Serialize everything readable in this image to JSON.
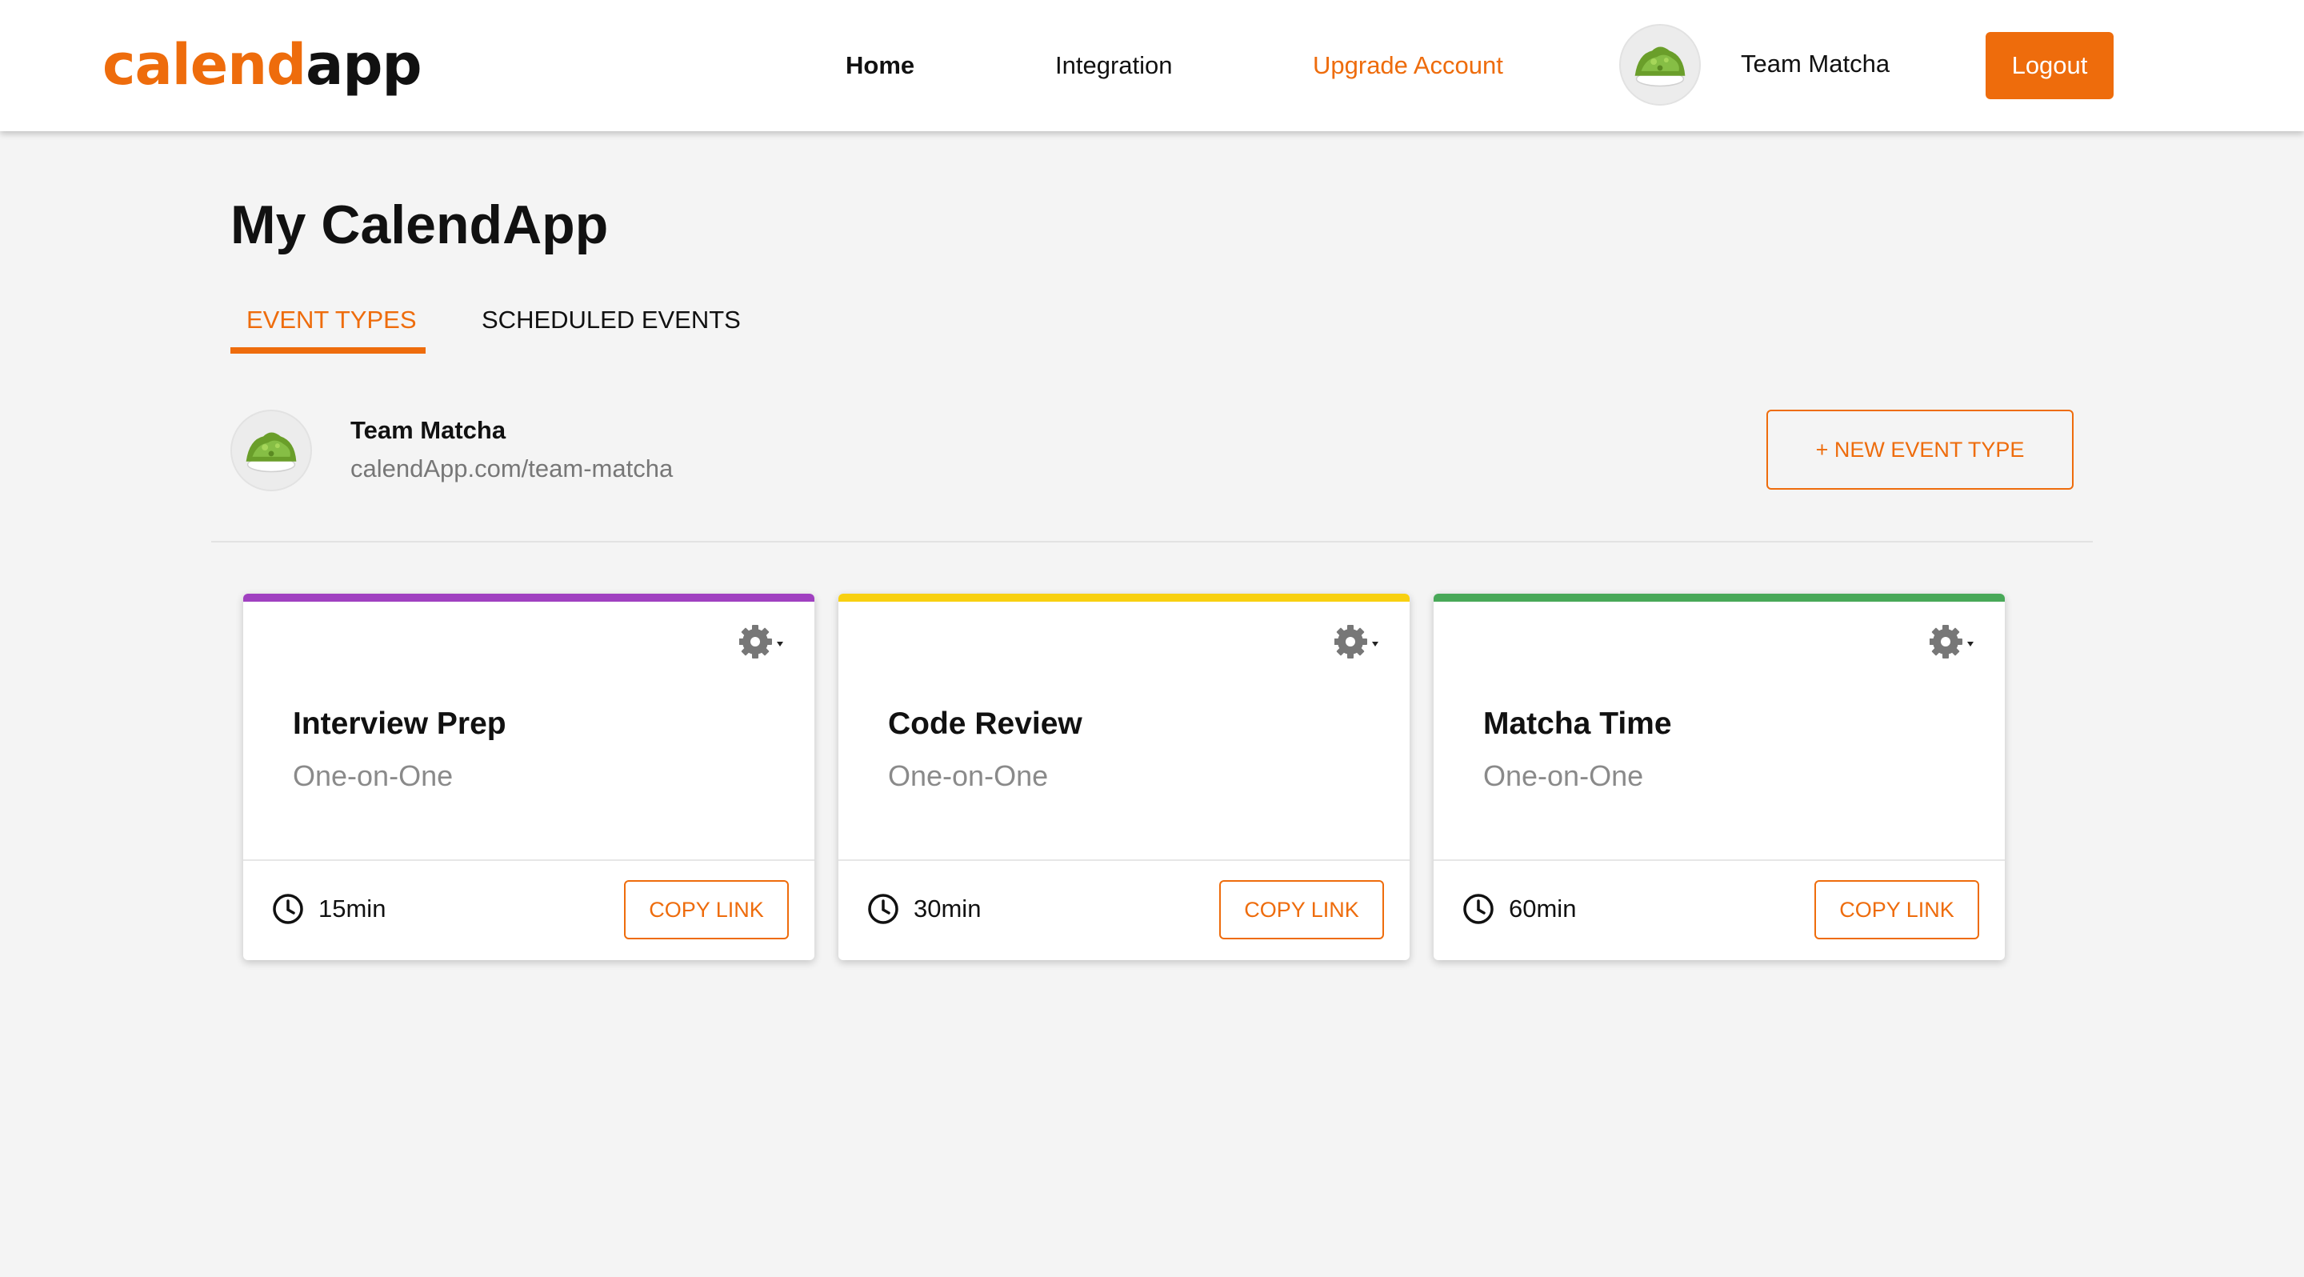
{
  "nav": {
    "logo_part1": "calend",
    "logo_part2": "app",
    "links": [
      {
        "label": "Home"
      },
      {
        "label": "Integration"
      },
      {
        "label": "Upgrade Account"
      }
    ],
    "user_name": "Team Matcha",
    "logout_label": "Logout"
  },
  "page": {
    "title": "My CalendApp",
    "tabs": [
      {
        "label": "EVENT TYPES",
        "active": true
      },
      {
        "label": "SCHEDULED EVENTS",
        "active": false
      }
    ]
  },
  "profile": {
    "name": "Team Matcha",
    "link": "calendApp.com/team-matcha",
    "new_event_label": "+ NEW EVENT TYPE"
  },
  "cards": [
    {
      "title": "Interview Prep",
      "subtitle": "One-on-One",
      "duration": "15min",
      "copy_label": "COPY LINK",
      "color": "#a040c0"
    },
    {
      "title": "Code Review",
      "subtitle": "One-on-One",
      "duration": "30min",
      "copy_label": "COPY LINK",
      "color": "#f8d010"
    },
    {
      "title": "Matcha Time",
      "subtitle": "One-on-One",
      "duration": "60min",
      "copy_label": "COPY LINK",
      "color": "#48a858"
    }
  ],
  "colors": {
    "accent": "#ee6c0c",
    "background": "#f4f4f4"
  },
  "icons": {
    "avatar": "matcha-bowl-avatar",
    "gear": "gear-icon",
    "clock": "clock-icon"
  }
}
